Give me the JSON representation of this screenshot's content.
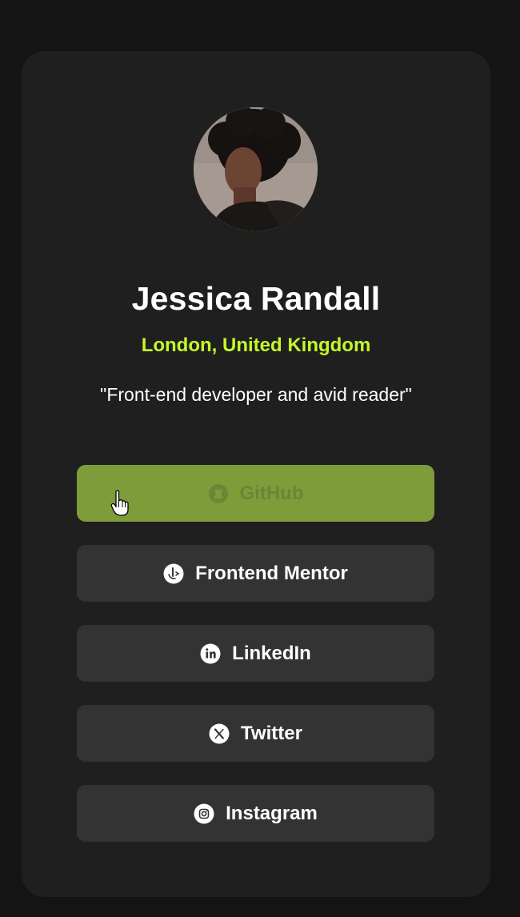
{
  "profile": {
    "name": "Jessica Randall",
    "location": "London, United Kingdom",
    "bio": "\"Front-end developer and avid reader\""
  },
  "links": [
    {
      "label": "GitHub",
      "icon": "github-icon",
      "state": "hover"
    },
    {
      "label": "Frontend Mentor",
      "icon": "frontend-mentor-icon"
    },
    {
      "label": "LinkedIn",
      "icon": "linkedin-icon"
    },
    {
      "label": "Twitter",
      "icon": "x-icon"
    },
    {
      "label": "Instagram",
      "icon": "instagram-icon"
    }
  ],
  "colors": {
    "background": "#141414",
    "card": "#1f1f1f",
    "accent": "#c4f82a",
    "button": "#333333",
    "button_hover": "#7f9c3a"
  }
}
